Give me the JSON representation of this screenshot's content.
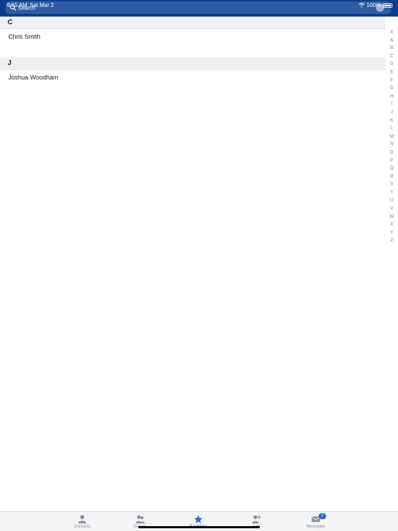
{
  "status": {
    "time": "8:55 AM",
    "date": "Sat Mar 2",
    "battery": "100%"
  },
  "search": {
    "placeholder": "Search"
  },
  "sections": [
    {
      "letter": "C",
      "contacts": [
        "Chris Smith"
      ]
    },
    {
      "letter": "J",
      "contacts": [
        "Joshua Woodham"
      ]
    }
  ],
  "index": [
    "#",
    "A",
    "B",
    "C",
    "D",
    "E",
    "F",
    "G",
    "H",
    "I",
    "J",
    "K",
    "L",
    "M",
    "N",
    "O",
    "P",
    "Q",
    "R",
    "S",
    "T",
    "U",
    "V",
    "W",
    "X",
    "Y",
    "Z"
  ],
  "tabs": [
    {
      "id": "contacts",
      "label": "Contacts",
      "icon": "person-icon",
      "active": false
    },
    {
      "id": "groups",
      "label": "Groups",
      "icon": "group-icon",
      "active": false
    },
    {
      "id": "favorites",
      "label": "Favorites",
      "icon": "star-icon",
      "active": true
    },
    {
      "id": "add",
      "label": "Add",
      "icon": "add-person-icon",
      "active": false
    },
    {
      "id": "messages",
      "label": "Messages",
      "icon": "envelope-icon",
      "active": false,
      "badge": "2"
    }
  ],
  "colors": {
    "header": "#0a3f8c",
    "accent": "#2d6ec4",
    "section_bg": "#eef0f3"
  }
}
